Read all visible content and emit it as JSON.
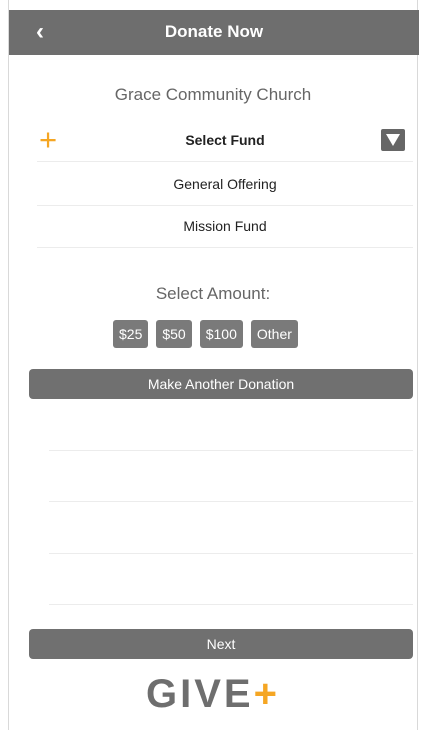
{
  "header": {
    "title": "Donate Now",
    "back_icon": "chevron-left-icon"
  },
  "church_name": "Grace Community Church",
  "fund": {
    "select_label": "Select Fund",
    "options": [
      "General Offering",
      "Mission Fund"
    ],
    "plus_icon": "plus-icon",
    "dropdown_icon": "triangle-down-icon"
  },
  "amount": {
    "label": "Select Amount:",
    "options": [
      "$25",
      "$50",
      "$100",
      "Other"
    ]
  },
  "another_donation_label": "Make Another Donation",
  "next_label": "Next",
  "logo": {
    "text": "GIVE",
    "plus": "+"
  },
  "colors": {
    "header_bg": "#6e6e6e",
    "accent": "#f5a623",
    "button_bg": "#707070"
  }
}
